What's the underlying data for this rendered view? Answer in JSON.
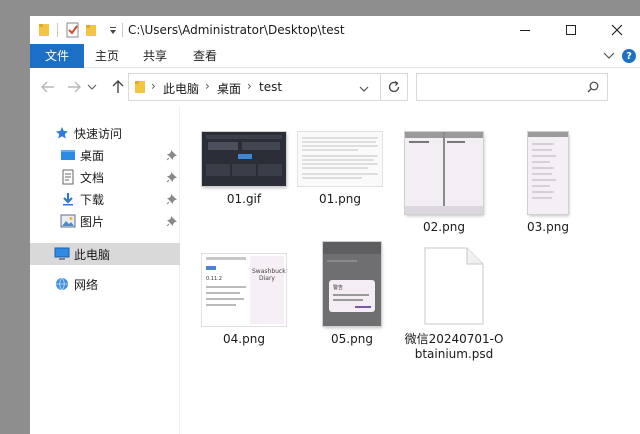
{
  "window": {
    "title": "C:\\Users\\Administrator\\Desktop\\test"
  },
  "ribbon": {
    "tabs": [
      "文件",
      "主页",
      "共享",
      "查看"
    ]
  },
  "address": {
    "crumbs": [
      "此电脑",
      "桌面",
      "test"
    ],
    "search_placeholder": ""
  },
  "navpane": {
    "quick_access": "快速访问",
    "items": [
      "桌面",
      "文档",
      "下载",
      "图片"
    ],
    "this_pc": "此电脑",
    "network": "网络"
  },
  "files": [
    {
      "name": "01.gif"
    },
    {
      "name": "01.png"
    },
    {
      "name": "02.png"
    },
    {
      "name": "03.png"
    },
    {
      "name": "04.png"
    },
    {
      "name": "05.png"
    },
    {
      "name": "微信20240701-Obtainium.psd"
    }
  ],
  "thumbnail_text": {
    "swashbuckler_title": "Swashbuckler Diary",
    "dialog_title": "警告",
    "version": "0.11.2"
  },
  "colors": {
    "accent": "#1b6fc7",
    "folder": "#f4c542",
    "selected": "#d9d9d9"
  }
}
